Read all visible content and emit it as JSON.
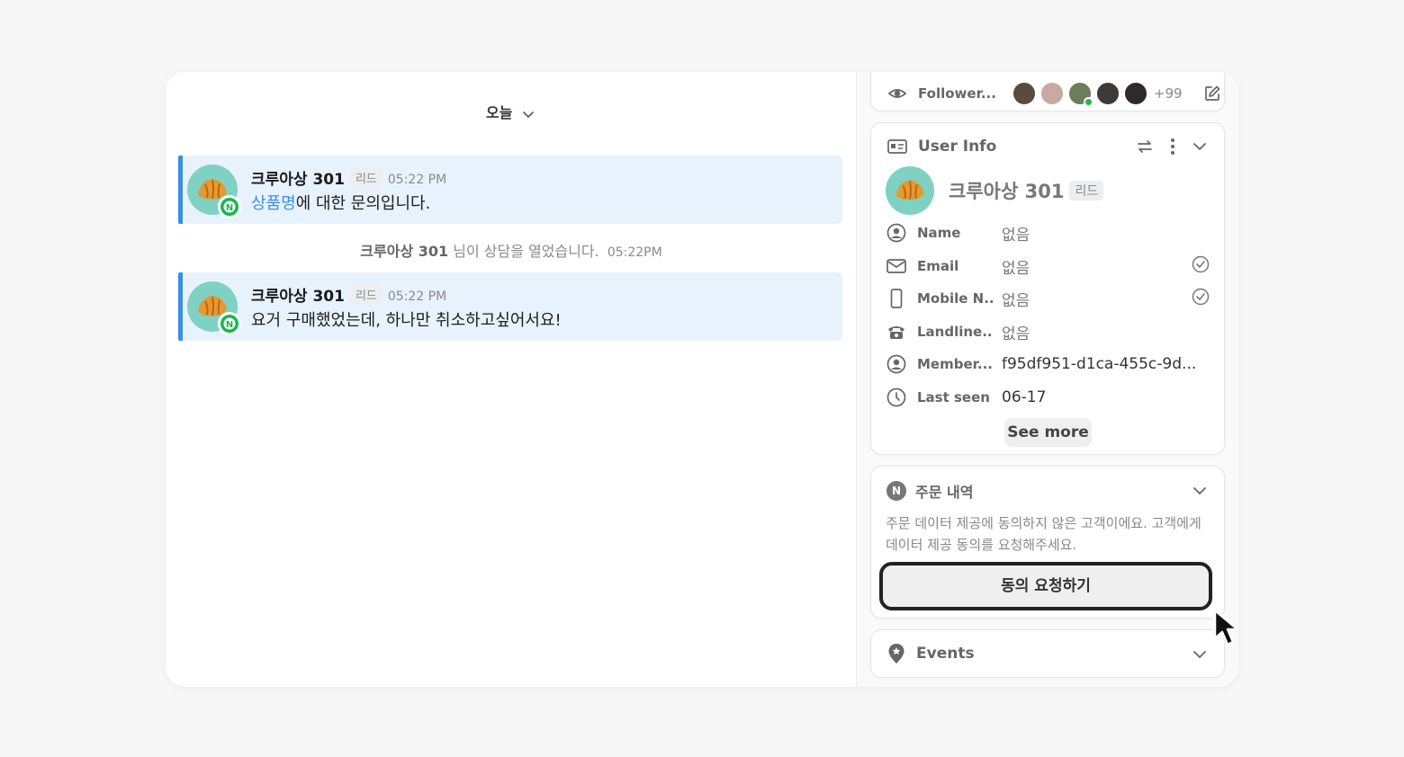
{
  "chat": {
    "date_label": "오늘",
    "messages": [
      {
        "sender": "크루아상 301",
        "tag": "리드",
        "time": "05:22 PM",
        "text_link": "상품명",
        "text": "에 대한 문의입니다."
      },
      {
        "sender": "크루아상 301",
        "tag": "리드",
        "time": "05:22 PM",
        "text": "요거 구매했었는데, 하나만 취소하고싶어서요!"
      }
    ],
    "system": {
      "name": "크루아상 301",
      "text": "님이 상담을 열었습니다.",
      "time": "05:22PM"
    }
  },
  "panel": {
    "followers": {
      "label": "Follower...",
      "more_count": "+99",
      "avatar_colors": [
        "#5b4a3e",
        "#c9a9a0",
        "#6b7d5a",
        "#3e3a38",
        "#2f2a27"
      ]
    },
    "user_info": {
      "title": "User Info",
      "name": "크루아상 301",
      "tag": "리드",
      "fields": [
        {
          "label": "Name",
          "value": "없음",
          "icon": "person-circle-icon"
        },
        {
          "label": "Email",
          "value": "없음",
          "icon": "mail-icon",
          "verified": true
        },
        {
          "label": "Mobile N...",
          "value": "없음",
          "icon": "mobile-phone-icon",
          "verified": true
        },
        {
          "label": "Landline...",
          "value": "없음",
          "icon": "telephone-icon"
        },
        {
          "label": "Member...",
          "value": "f95df951-d1ca-455c-9d...",
          "icon": "member-id-icon"
        },
        {
          "label": "Last seen",
          "value": "06-17",
          "icon": "clock-icon"
        }
      ],
      "see_more": "See more"
    },
    "orders": {
      "title": "주문 내역",
      "notice": "주문 데이터 제공에 동의하지 않은 고객이에요. 고객에게 데이터 제공 동의를 요청해주세요.",
      "button": "동의 요청하기"
    },
    "events": {
      "title": "Events"
    }
  },
  "colors": {
    "accent_blue": "#3a8fe3",
    "message_bg": "#e8f2fc",
    "naver_green": "#12b94c"
  }
}
